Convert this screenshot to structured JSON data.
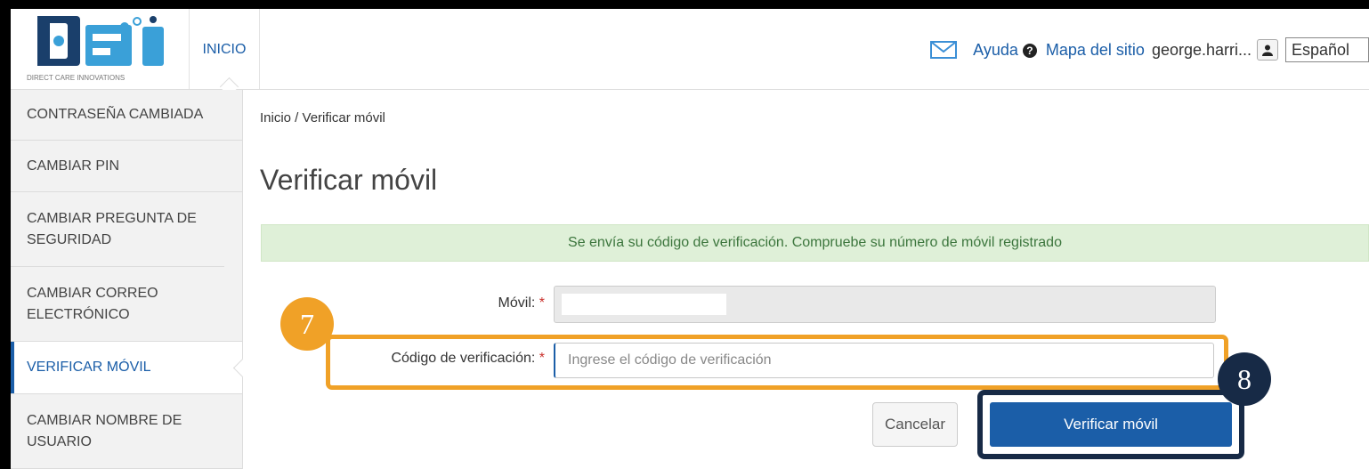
{
  "header": {
    "logo_text": "DIRECT CARE INNOVATIONS",
    "home_tab": "INICIO",
    "help": "Ayuda",
    "help_icon": "question-circle-icon",
    "sitemap": "Mapa del sitio",
    "username": "george.harri...",
    "language": "Español",
    "icons": {
      "mail": "envelope-icon",
      "user": "user-icon"
    }
  },
  "sidebar": {
    "items": [
      {
        "label": "CONTRASEÑA CAMBIADA"
      },
      {
        "label": "CAMBIAR PIN"
      },
      {
        "label": "CAMBIAR PREGUNTA DE SEGURIDAD"
      },
      {
        "label": "CAMBIAR CORREO ELECTRÓNICO"
      },
      {
        "label": "VERIFICAR MÓVIL",
        "active": true
      },
      {
        "label": "CAMBIAR NOMBRE DE USUARIO"
      }
    ]
  },
  "main": {
    "breadcrumb": "Inicio / Verificar móvil",
    "title": "Verificar móvil",
    "alert": "Se envía su código de verificación. Compruebe su número de móvil registrado",
    "mobile_label": "Móvil:",
    "code_label": "Código de verificación:",
    "required_mark": "*",
    "code_placeholder": "Ingrese el código de verificación",
    "cancel": "Cancelar",
    "submit": "Verificar móvil"
  },
  "annotations": {
    "step7": "7",
    "step8": "8"
  },
  "colors": {
    "brand_blue": "#1b5ea8",
    "alert_bg": "#dff0d8",
    "alert_text": "#3c763d",
    "step7_orange": "#f0a127",
    "step8_navy": "#172a46"
  }
}
